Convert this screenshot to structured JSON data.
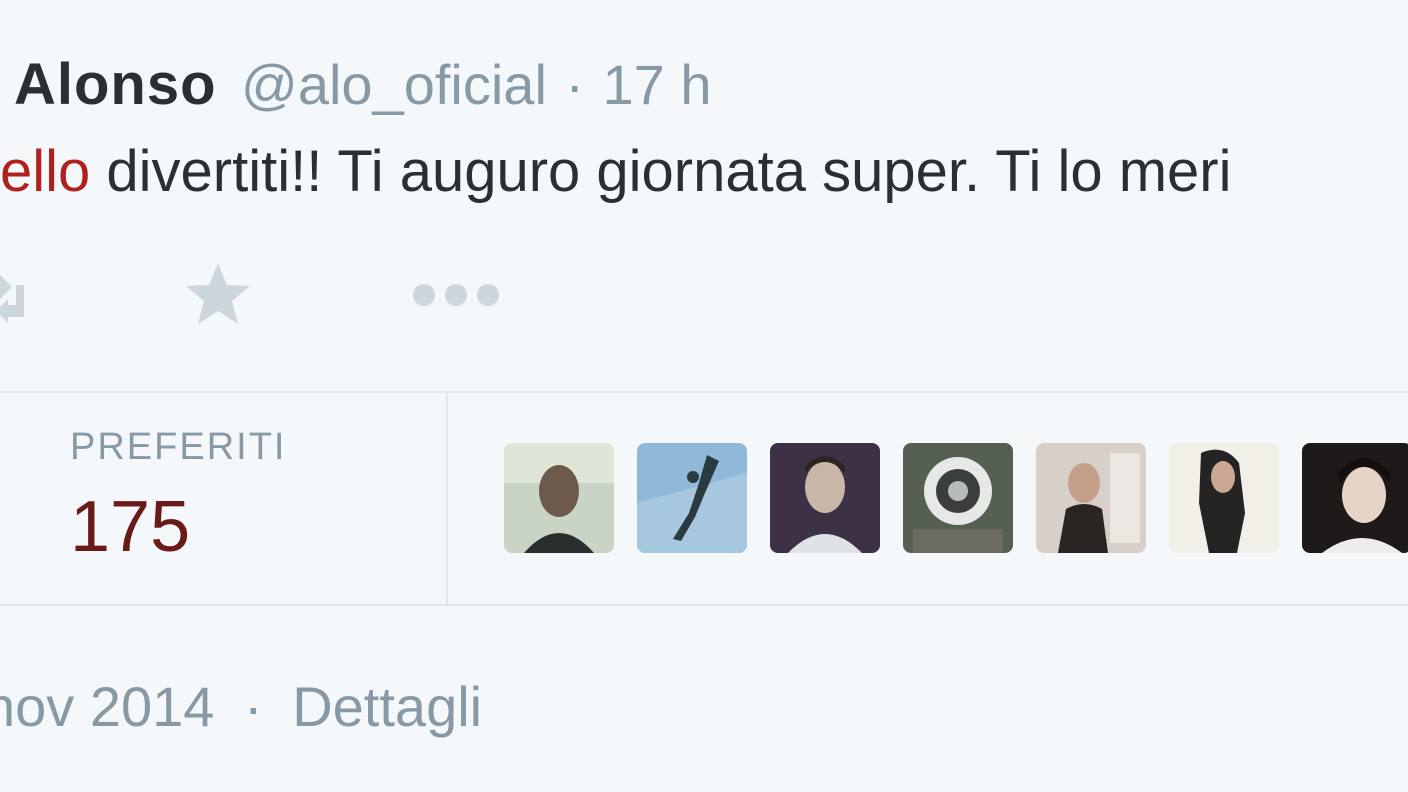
{
  "tweet": {
    "author_name": "Alonso",
    "handle": "@alo_oficial",
    "separator": "·",
    "time": "17 h",
    "text_link": "ello",
    "text_rest": " divertiti!! Ti auguro giornata super. Ti lo meri"
  },
  "actions": {
    "retweet_icon": "retweet-icon",
    "favorite_icon": "star-icon",
    "more_icon": "more-dots-icon"
  },
  "stats": {
    "favorites_label": "PREFERITI",
    "favorites_count": "175"
  },
  "avatars": [
    {
      "name": "avatar-1",
      "bg": "#c9d4c4",
      "fg": "#2a2e2c"
    },
    {
      "name": "avatar-2",
      "bg": "#8fb8d9",
      "fg": "#2b3a40"
    },
    {
      "name": "avatar-3",
      "bg": "#3c3145",
      "fg": "#c8b6a8"
    },
    {
      "name": "avatar-4",
      "bg": "#556052",
      "fg": "#e7e7e7"
    },
    {
      "name": "avatar-5",
      "bg": "#d8cfc8",
      "fg": "#2a2423"
    },
    {
      "name": "avatar-6",
      "bg": "#f2efe8",
      "fg": "#262324"
    },
    {
      "name": "avatar-7",
      "bg": "#1e1a19",
      "fg": "#e8d4c7"
    }
  ],
  "footer": {
    "date": "nov 2014",
    "separator": "·",
    "details_link": "Dettagli"
  },
  "colors": {
    "background": "#f5f8fa",
    "text": "#292f33",
    "muted": "#8899a6",
    "link": "#b0201f",
    "count": "#6b1a1a",
    "icon": "#ccd6dd",
    "divider": "#e1e8ed"
  }
}
